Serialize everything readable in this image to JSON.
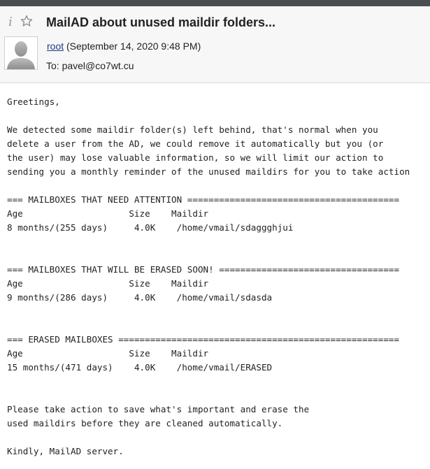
{
  "header": {
    "subject": "MailAD about unused maildir folders...",
    "sender_name": "root",
    "sent_datetime": "(September 14, 2020 9:48 PM)",
    "to_line": "To: pavel@co7wt.cu",
    "icons": [
      "info-icon",
      "star-icon",
      "avatar"
    ]
  },
  "message": {
    "lines": [
      "Greetings,",
      "",
      "We detected some maildir folder(s) left behind, that's normal when you",
      "delete a user from the AD, we could remove it automatically but you (or",
      "the user) may lose valuable information, so we will limit our action to",
      "sending you a monthly reminder of the unused maildirs for you to take action",
      "",
      "=== MAILBOXES THAT NEED ATTENTION ========================================",
      "Age                    Size    Maildir",
      "8 months/(255 days)     4.0K    /home/vmail/sdaggghjui",
      "",
      "",
      "=== MAILBOXES THAT WILL BE ERASED SOON! ==================================",
      "Age                    Size    Maildir",
      "9 months/(286 days)     4.0K    /home/vmail/sdasda",
      "",
      "",
      "=== ERASED MAILBOXES =====================================================",
      "Age                    Size    Maildir",
      "15 months/(471 days)    4.0K    /home/vmail/ERASED",
      "",
      "",
      "Please take action to save what's important and erase the",
      "used maildirs before they are cleaned automatically.",
      "",
      "Kindly, MailAD server."
    ]
  }
}
